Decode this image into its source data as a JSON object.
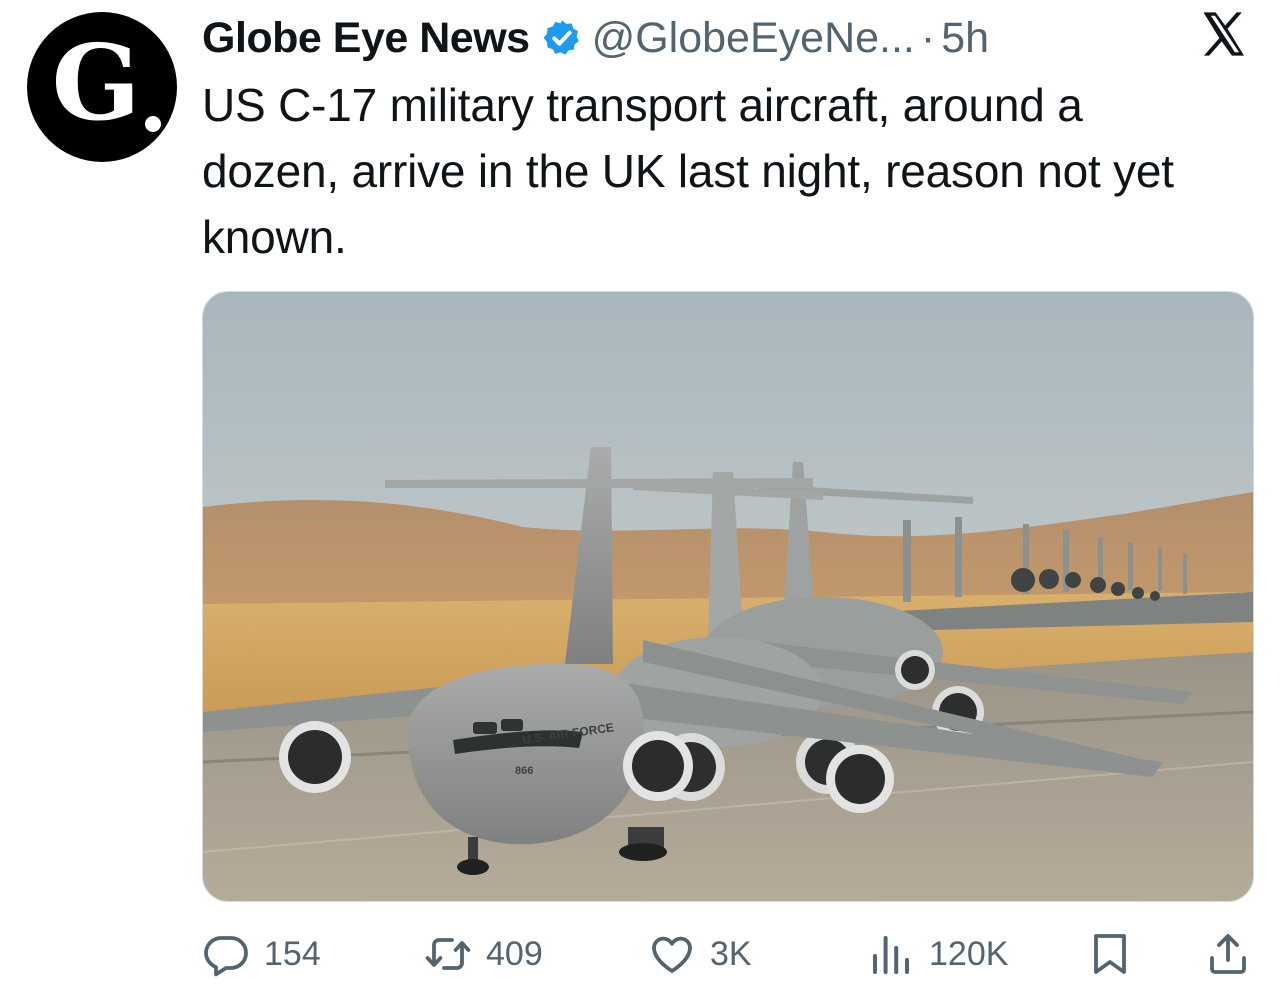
{
  "tweet": {
    "author_name": "Globe Eye News",
    "avatar_letter": "G",
    "handle": "@GlobeEyeNe...",
    "separator": "·",
    "time": "5h",
    "verified": true,
    "text": "US C-17 military transport aircraft, around a dozen, arrive in the UK last night, reason not yet known."
  },
  "media": {
    "photo_markings": "U.S. AIR FORCE",
    "tail_number": "866"
  },
  "actions": {
    "replies": "154",
    "reposts": "409",
    "likes": "3K",
    "views": "120K"
  },
  "icons": {
    "close": "x-logo-icon",
    "reply": "reply-icon",
    "repost": "repost-icon",
    "like": "heart-icon",
    "views": "views-icon",
    "bookmark": "bookmark-icon",
    "share": "share-icon"
  },
  "colors": {
    "verified_blue": "#1d9bf0",
    "text_primary": "#0f1419",
    "text_secondary": "#536471"
  }
}
